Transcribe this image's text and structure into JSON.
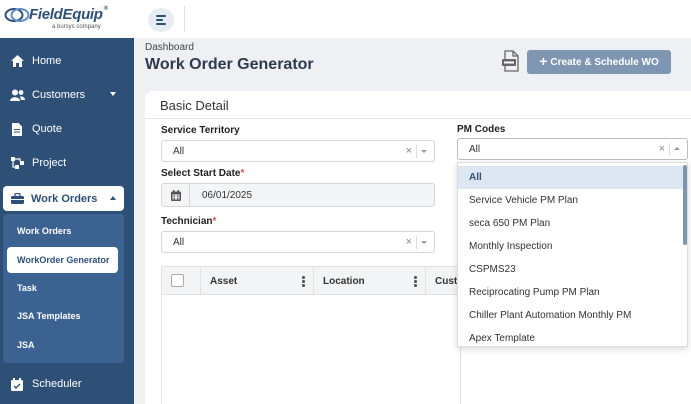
{
  "brand": {
    "name": "FieldEquip",
    "tagline": "a bursys company",
    "tm": "®"
  },
  "sidebar": {
    "items": [
      {
        "label": "Home",
        "icon": "home-icon"
      },
      {
        "label": "Customers",
        "icon": "users-icon"
      },
      {
        "label": "Quote",
        "icon": "document-icon"
      },
      {
        "label": "Project",
        "icon": "project-icon"
      }
    ],
    "active_label": "Work Orders",
    "submenu": [
      "Work Orders",
      "WorkOrder Generator",
      "Task",
      "JSA Templates",
      "JSA"
    ],
    "submenu_active": "WorkOrder Generator",
    "scheduler_label": "Scheduler"
  },
  "header": {
    "breadcrumb": "Dashboard",
    "title": "Work Order Generator",
    "create_button": "Create & Schedule WO",
    "create_plus": "+"
  },
  "form": {
    "section_title": "Basic Detail",
    "service_territory": {
      "label": "Service Territory",
      "value": "All"
    },
    "pm_codes": {
      "label": "PM Codes",
      "value": "All"
    },
    "start_date": {
      "label": "Select Start Date",
      "required": "*",
      "value": "06/01/2025"
    },
    "technician": {
      "label": "Technician",
      "required": "*",
      "value": "All"
    },
    "clear_glyph": "×"
  },
  "table": {
    "columns": [
      "Asset",
      "Location",
      "Cust"
    ]
  },
  "dropdown": {
    "options": [
      "All",
      "Service Vehicle PM Plan",
      "seca 650 PM Plan",
      "Monthly Inspection",
      "CSPMS23",
      "Reciprocating Pump PM Plan",
      "Chiller Plant Automation Monthly PM",
      "Apex Template"
    ],
    "selected": "All"
  },
  "colors": {
    "sidebar": "#2e5077",
    "submenu": "#3b6290",
    "button": "#7f96b2",
    "required": "#d9534f"
  }
}
